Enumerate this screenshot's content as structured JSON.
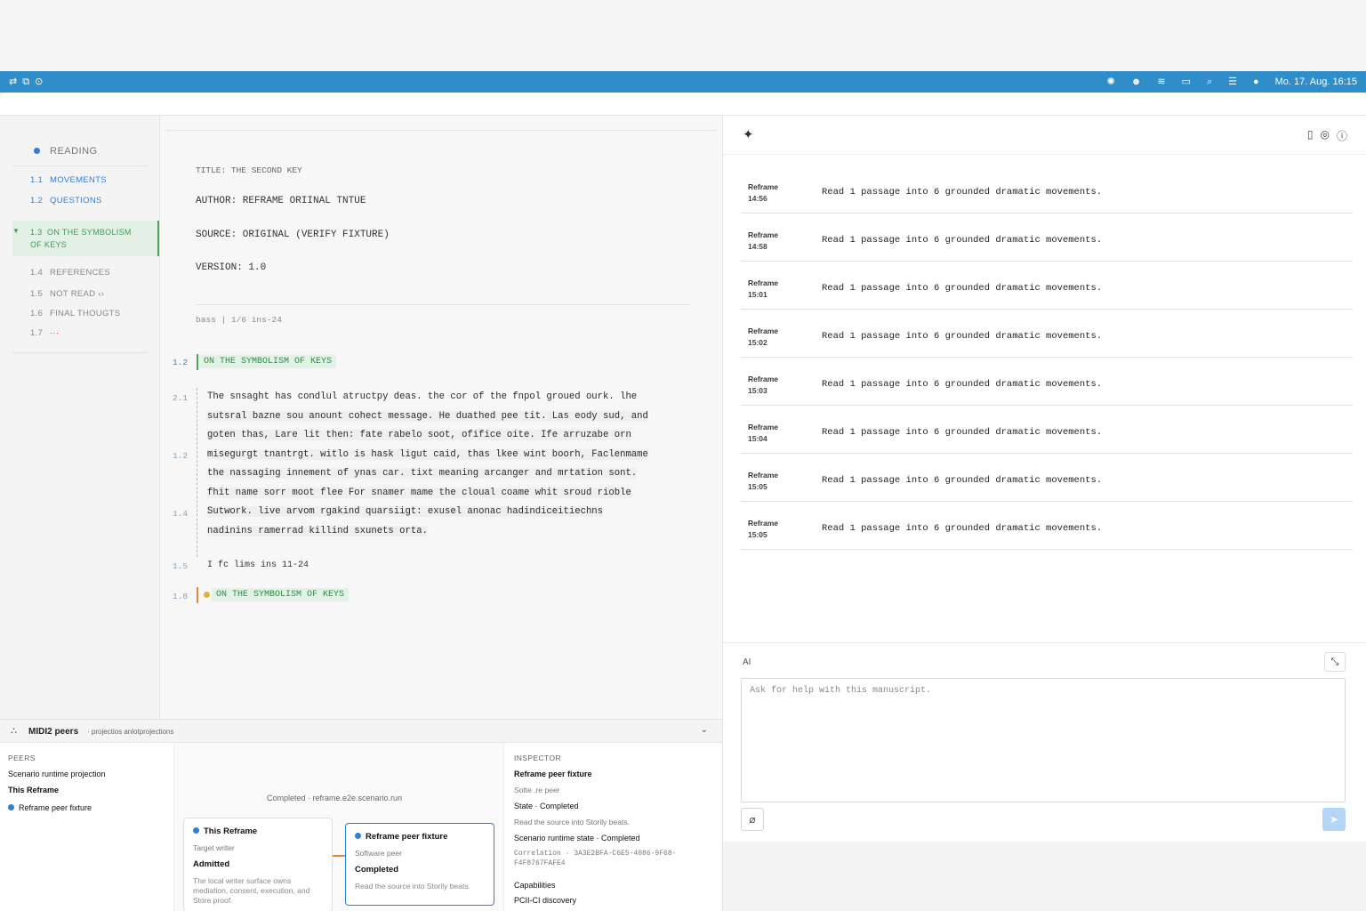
{
  "menubar": {
    "left_icons": [
      "swap-icon",
      "network-icon",
      "lock-icon"
    ],
    "right_icons": [
      "openai-icon",
      "smiley-icon",
      "wifi-icon",
      "battery-icon",
      "search-icon",
      "control-center-icon",
      "siri-icon"
    ],
    "datetime": "Mo. 17. Aug.  16:15"
  },
  "outline": {
    "heading": "READING",
    "items": [
      {
        "num": "1.1",
        "label": "MOVEMENTS"
      },
      {
        "num": "1.2",
        "label": "QUESTIONS"
      },
      {
        "num": "1.3",
        "label": "ON THE SYMBOLISM\nOF KEYS"
      },
      {
        "num": "1.4",
        "label": "REFERENCES"
      },
      {
        "num": "1.5",
        "label": "NOT READ  ‹›"
      },
      {
        "num": "1.6",
        "label": "FINAL THOUGTS"
      },
      {
        "num": "1.7",
        "label": "···"
      }
    ]
  },
  "document": {
    "title_line": "TITLE: THE SECOND KEY",
    "author_line": "AUTHOR: REFRAME ORIINAL TNTUE",
    "source_line": "SOURCE: ORIGINAL (VERIFY FIXTURE)",
    "version_line": "VERSION: 1.0",
    "status_line": "bass | 1/6 ins-24",
    "section_head_num": "1.2",
    "section_head": "ON THE SYMBOLISM OF KEYS",
    "line_numbers": [
      "2.1",
      "1.2",
      "1.4"
    ],
    "paragraph": [
      "The snsaght has condlul atructpy deas. the cor of the fnpol groued ourk. lhe",
      "sutsral bazne sou anount cohect message. He duathed pee tit. Las eody sud, and",
      "goten thas, Lare lit then: fate rabelo soot, ofifice oite. Ife arruzabe orn",
      "misegurgt tnantrgt. witlo is hask ligut caid, thas lkee wint boorh, Faclenmame",
      "the nassaging innement of ynas car. tixt meaning arcanger and mrtation sont.",
      "fhit name sorr moot flee For snamer mame the cloual coame whit sroud rioble",
      "Sutwork. live arvom rgakind quarsiigt: exusel anonac hadindiceitiechns",
      "nadinins ramerrad killind sxunets orta."
    ],
    "note_num": "1.5",
    "note_text": "I  fc  lims  ins  11-24",
    "footer_num": "1.8",
    "footer_head": "ON THE SYMBOLISM OF KEYS"
  },
  "ai_panel": {
    "log": [
      {
        "who": "Reframe",
        "time": "14:56",
        "msg": "Read 1 passage into 6 grounded dramatic movements."
      },
      {
        "who": "Reframe",
        "time": "14:58",
        "msg": "Read 1 passage into 6 grounded dramatic movements."
      },
      {
        "who": "Reframe",
        "time": "15:01",
        "msg": "Read 1 passage into 6 grounded dramatic movements."
      },
      {
        "who": "Reframe",
        "time": "15:02",
        "msg": "Read 1 passage into 6 grounded dramatic movements."
      },
      {
        "who": "Reframe",
        "time": "15:03",
        "msg": "Read 1 passage into 6 grounded dramatic movements."
      },
      {
        "who": "Reframe",
        "time": "15:04",
        "msg": "Read 1 passage into 6 grounded dramatic movements."
      },
      {
        "who": "Reframe",
        "time": "15:05",
        "msg": "Read 1 passage into 6 grounded dramatic movements."
      },
      {
        "who": "Reframe",
        "time": "15:05",
        "msg": "Read 1 passage into 6 grounded dramatic movements."
      }
    ],
    "composer_label": "AI",
    "composer_placeholder": "Ask for help with this manuscript."
  },
  "peers_panel": {
    "title": "MIDI2 peers",
    "subtitle": "· projectios anlotprojections",
    "list_heading": "PEERS",
    "list_items": [
      "Scenario runtime projection",
      "This Reframe",
      "Reframe peer fixture"
    ],
    "canvas_status": "Completed · reframe.e2e.scenario.run",
    "card_local": {
      "title": "This Reframe",
      "role": "Target writer",
      "state": "Admitted",
      "desc": "The local writer surface owns mediation, consent, execution, and Store proof."
    },
    "card_peer": {
      "title": "Reframe peer fixture",
      "role": "Software peer",
      "state": "Completed",
      "desc": "Read the source into Storily beats."
    },
    "inspector": {
      "heading": "INSPECTOR",
      "name": "Reframe peer fixture",
      "kind": "Sotte .re peer",
      "state": "State · Completed",
      "note": "Read the source into Storily beats.",
      "scenario": "Scenario runtime state · Completed",
      "correlation": "Correlation  · 3A3E2BFA-C6E5-4086-9F68-F4F8767FAFE4",
      "capabilities": "Capabilities",
      "discovery": "PCII-CI discovery"
    }
  }
}
